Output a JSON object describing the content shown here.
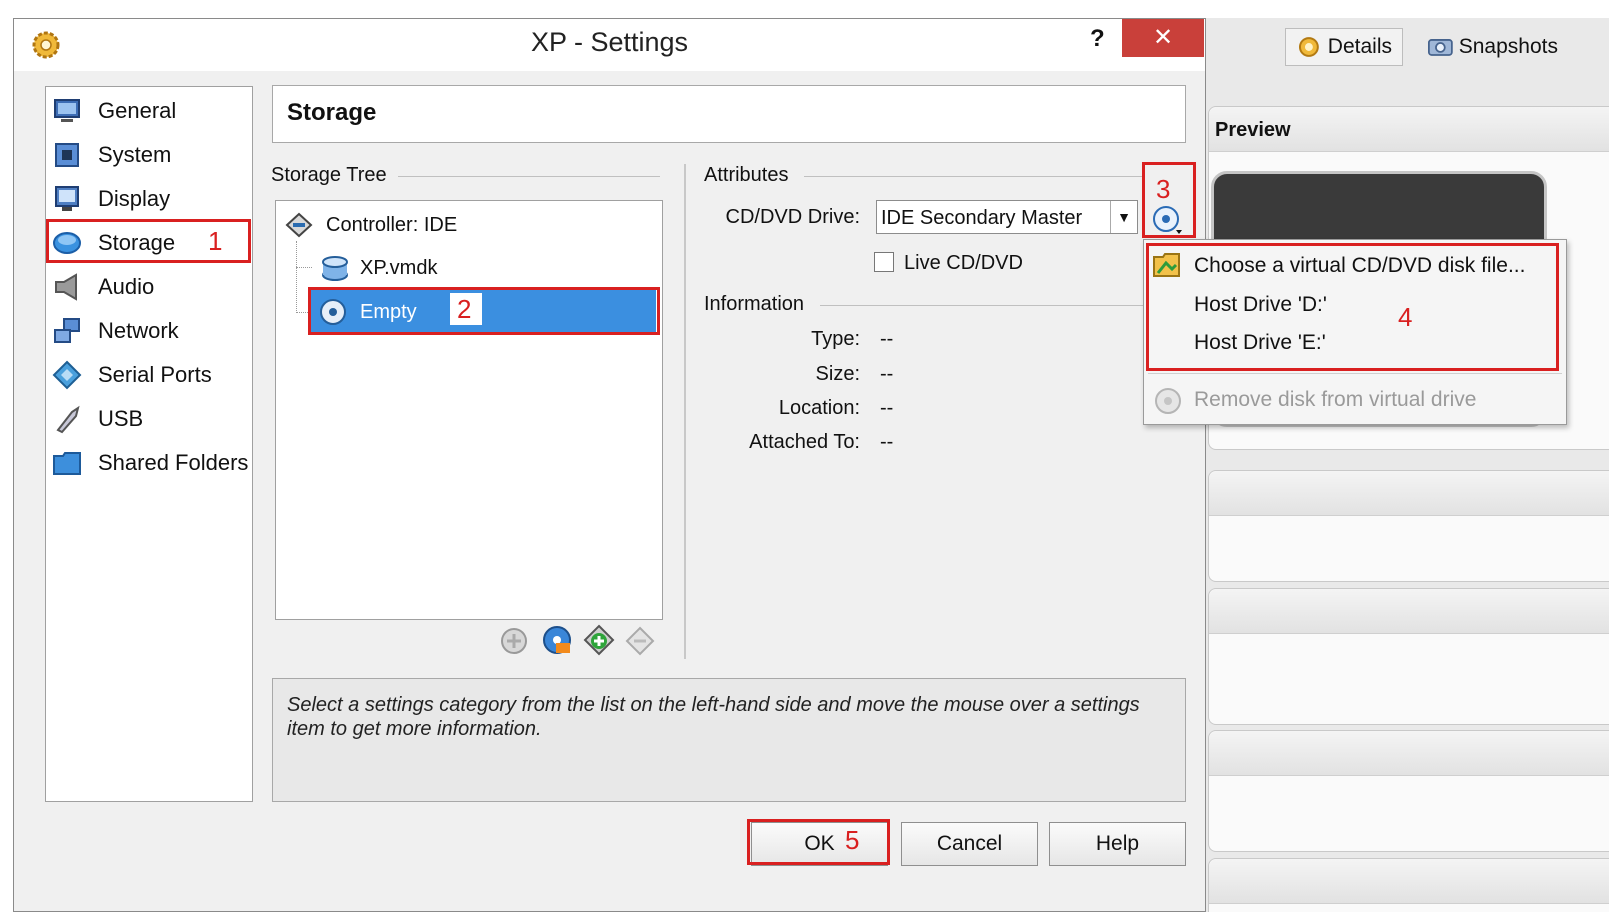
{
  "dialog": {
    "title": "XP - Settings",
    "help_glyph": "?",
    "close_glyph": "✕"
  },
  "manager": {
    "details_label": "Details",
    "snapshots_label": "Snapshots",
    "preview_label": "Preview"
  },
  "categories": [
    {
      "label": "General",
      "icon": "monitor-icon"
    },
    {
      "label": "System",
      "icon": "chip-icon"
    },
    {
      "label": "Display",
      "icon": "display-icon"
    },
    {
      "label": "Storage",
      "icon": "storage-disc-icon"
    },
    {
      "label": "Audio",
      "icon": "speaker-icon"
    },
    {
      "label": "Network",
      "icon": "network-icon"
    },
    {
      "label": "Serial Ports",
      "icon": "serial-port-icon"
    },
    {
      "label": "USB",
      "icon": "usb-icon"
    },
    {
      "label": "Shared Folders",
      "icon": "folder-icon"
    }
  ],
  "selected_category": "Storage",
  "page_header": "Storage",
  "storage_tree": {
    "label": "Storage Tree",
    "controller": "Controller: IDE",
    "disk": "XP.vmdk",
    "optical": "Empty"
  },
  "attributes": {
    "label": "Attributes",
    "cd_drive_label": "CD/DVD Drive:",
    "cd_drive_value": "IDE Secondary Master",
    "live_cd_label": "Live CD/DVD",
    "live_cd_checked": false
  },
  "information": {
    "label": "Information",
    "type_label": "Type:",
    "type_value": "--",
    "size_label": "Size:",
    "size_value": "--",
    "location_label": "Location:",
    "location_value": "--",
    "attached_label": "Attached To:",
    "attached_value": "--"
  },
  "popup_menu": {
    "choose_file": "Choose a virtual CD/DVD disk file...",
    "host_d": "Host Drive 'D:'",
    "host_e": "Host Drive 'E:'",
    "remove": "Remove disk from virtual drive"
  },
  "info_text": "Select a settings category from the list on the left-hand side and move the mouse over a settings item to get more information.",
  "buttons": {
    "ok": "OK",
    "cancel": "Cancel",
    "help": "Help"
  },
  "annotations": {
    "step1": "1",
    "step2": "2",
    "step3": "3",
    "step4": "4",
    "step5": "5"
  },
  "colors": {
    "annotation_red": "#d92020",
    "selection_blue": "#3b8fe0",
    "close_red": "#c9403a"
  }
}
